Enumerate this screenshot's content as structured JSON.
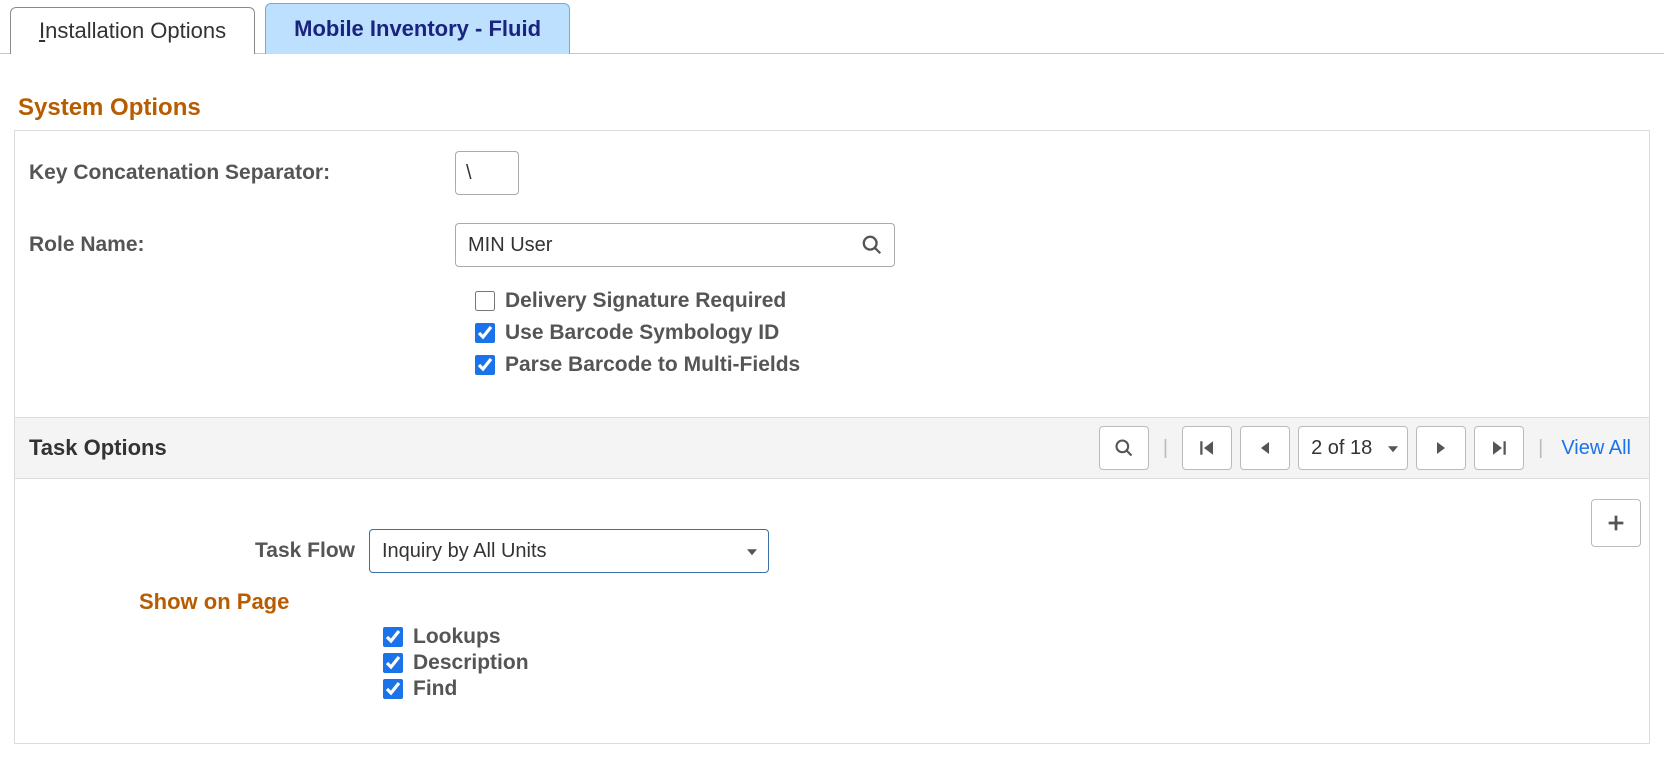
{
  "tabs": {
    "installation_prefix": "I",
    "installation_rest": "nstallation Options",
    "mobile": "Mobile Inventory - Fluid"
  },
  "section_title": "System Options",
  "fields": {
    "key_sep_label": "Key Concatenation Separator:",
    "key_sep_value": "\\",
    "role_name_label": "Role Name:",
    "role_name_value": "MIN User"
  },
  "checkboxes": {
    "delivery_sig": "Delivery Signature Required",
    "barcode_sym": "Use Barcode Symbology ID",
    "parse_barcode": "Parse Barcode to Multi-Fields"
  },
  "task_options": {
    "title": "Task Options",
    "page_indicator": "2 of 18",
    "view_all": "View All",
    "task_flow_label": "Task Flow",
    "task_flow_value": "Inquiry by All Units",
    "show_on_page": "Show on Page",
    "lookups": "Lookups",
    "description": "Description",
    "find": "Find"
  }
}
